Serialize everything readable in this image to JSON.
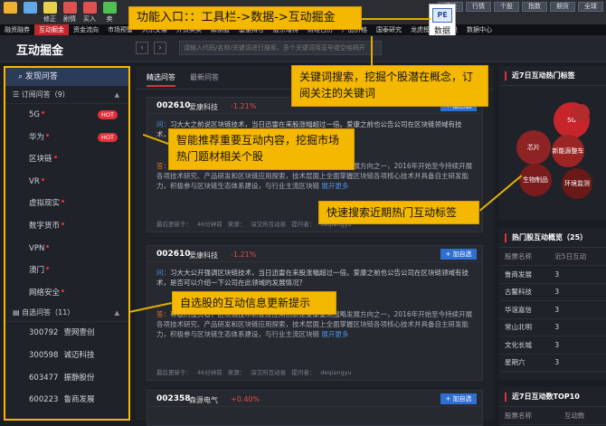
{
  "toolbar": {
    "items": [
      {
        "label": "",
        "icon": "back-arrow-icon",
        "color": "#f0b030"
      },
      {
        "label": "",
        "icon": "home-icon",
        "color": "#5fa9e8"
      },
      {
        "label": "修正",
        "icon": "edit-icon",
        "color": "#e8d04a"
      },
      {
        "label": "剧情",
        "icon": "chart-icon",
        "color": "#e05050"
      },
      {
        "label": "买入",
        "icon": "buy-icon",
        "color": "#e05050"
      },
      {
        "label": "卖",
        "icon": "sell-icon",
        "color": "#50c050"
      }
    ],
    "right": [
      "板块",
      "行情",
      "个股",
      "指数",
      "期货",
      "全球"
    ]
  },
  "menubar": [
    "融资融券",
    "互动掘金",
    "资金流向",
    "市场预警",
    "大宗交易",
    "外资买卖",
    "解禁股",
    "基金持仓",
    "股东增持",
    "财经日历",
    "产品价格",
    "国泰研究",
    "龙虎榜",
    "热门股",
    "数据中心"
  ],
  "menubar_active": 1,
  "pe_button": {
    "icon": "PE",
    "label": "数据"
  },
  "header": {
    "title": "互动掘金",
    "prev": "‹",
    "next": "›",
    "search_placeholder": "请输入代码/名称/关键词进行搜索，多个关键词用逗号或空格隔开"
  },
  "sidebar": {
    "top": "发现问答",
    "sub_section": "订阅问答（9）",
    "sub_items": [
      {
        "label": "5G",
        "hot": "HOT"
      },
      {
        "label": "华为",
        "hot": "HOT"
      },
      {
        "label": "区块链",
        "hot": ""
      },
      {
        "label": "VR",
        "hot": ""
      },
      {
        "label": "虚拟现实",
        "hot": ""
      },
      {
        "label": "数字货币",
        "hot": ""
      },
      {
        "label": "VPN",
        "hot": ""
      },
      {
        "label": "澳门",
        "hot": ""
      },
      {
        "label": "网络安全",
        "hot": ""
      }
    ],
    "self_section": "自选问答（11）",
    "stocks": [
      {
        "code": "300792",
        "name": "壹网壹创"
      },
      {
        "code": "300598",
        "name": "诚迈科技"
      },
      {
        "code": "603477",
        "name": "振静股份"
      },
      {
        "code": "600223",
        "name": "鲁商发展"
      }
    ]
  },
  "main": {
    "tabs": [
      "精选问答",
      "最新问答"
    ],
    "cards": [
      {
        "code": "002610",
        "name": "爱康科技",
        "pct": "-1.21%",
        "add": "+ 加自选",
        "q_prefix": "问：",
        "q": "习大大之前说区块链技术，当日迅雷在来股涨幅超过一倍。爱康之前也公告公司在区块链领域有技术，是否可以介绍一下公司在此领域的发展情况？",
        "a_prefix": "答：",
        "a": "尊敬的投资者，区块链技术研发及应用创新是爱康重点战略发展方向之一，2016年开始至今持续开展各项技术研究、产品研发和区块链应用探索，技术层面上全面掌握区块链各项核心技术并具备自主研发能力，积极参与区块链生态体系建设，与行业主流区块链",
        "more": "展开更多",
        "updated": "最后更新于：",
        "time": "46分钟前",
        "source_l": "来源：",
        "source": "深交所互动易",
        "user_l": "提问者：",
        "user": "deqiangyu"
      },
      {
        "code": "002610",
        "name": "爱康科技",
        "pct": "-1.21%",
        "add": "+ 加自选",
        "q_prefix": "问：",
        "q": "习大大公开强调区块链技术，当日迅雷在来股涨幅超过一倍。爱康之前也公告公司在区块链领域有技术，是否可以介绍一下公司在此领域的发展情况？",
        "a_prefix": "答：",
        "a": "尊敬的投资者，区块链技术研发及应用创新是爱康重点战略发展方向之一，2016年开始至今持续开展各项技术研究、产品研发和区块链应用探索，技术层面上全面掌握区块链各项核心技术并具备自主研发能力，积极参与区块链生态体系建设，与行业主流区块链",
        "more": "展开更多",
        "updated": "最后更新于：",
        "time": "46分钟前",
        "source_l": "来源：",
        "source": "深交所互动易",
        "user_l": "提问者：",
        "user": "deqiangyu"
      },
      {
        "code": "002358",
        "name": "森源电气",
        "pct": "+0.40%",
        "add": "+ 加自选"
      }
    ]
  },
  "right_panel": {
    "tags_title": "近7日互动热门标签",
    "bubbles": [
      {
        "label": "5G",
        "color": "#c8242c"
      },
      {
        "label": "芯片",
        "color": "#8e2323"
      },
      {
        "label": "新能源整车",
        "color": "#9b2424"
      },
      {
        "label": "生物制品",
        "color": "#7a1c1c"
      },
      {
        "label": "环境监测",
        "color": "#6a1818"
      },
      {
        "label": "",
        "color": "#b52a2a"
      }
    ],
    "overview_title": "热门股互动概览（25）",
    "overview_headers": [
      "股票名称",
      "近5日互动"
    ],
    "overview_rows": [
      [
        "鲁商发展",
        "3"
      ],
      [
        "古鳌科技",
        "3"
      ],
      [
        "华谊嘉信",
        "3"
      ],
      [
        "常山北明",
        "3"
      ],
      [
        "文化长城",
        "3"
      ],
      [
        "星期六",
        "3"
      ]
    ],
    "top10_title": "近7日互动数TOP10",
    "top10_headers": [
      "股票名称",
      "互动数"
    ]
  },
  "annotations": {
    "a1": "功能入口：：工具栏->数据->互动掘金",
    "a2": "关键词搜索，挖掘个股潜在概念，订阅关注的关键词",
    "a3": "智能推荐重要互动内容，挖掘市场热门题材相关个股",
    "a4": "快速搜索近期热门互动标签",
    "a5": "自选股的互动信息更新提示"
  }
}
